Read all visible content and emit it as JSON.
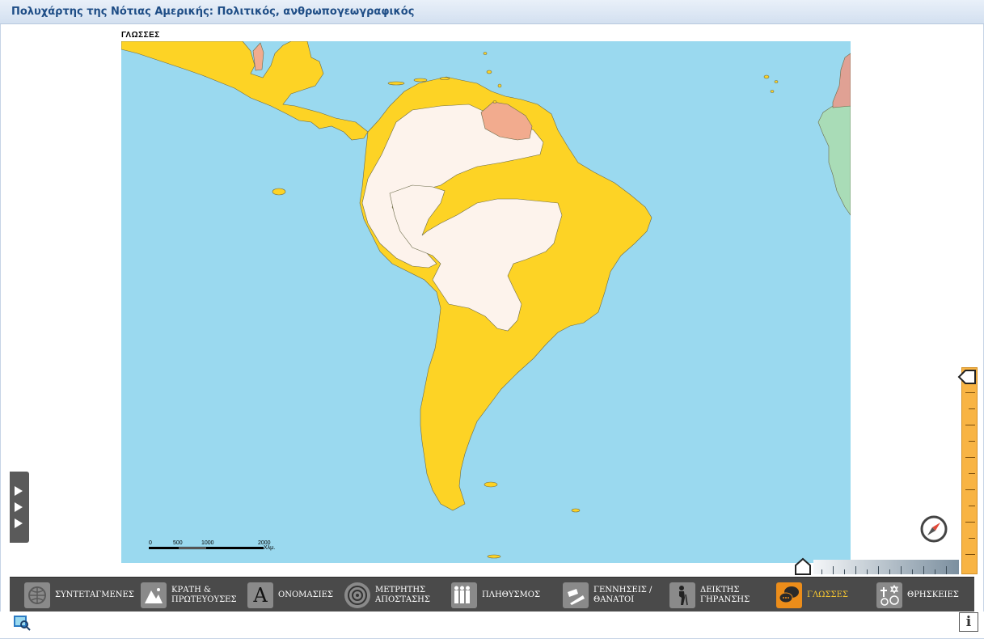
{
  "title": "Πολυχάρτης της Νότιας Αμερικής: Πολιτικός, ανθρωπογεωγραφικός",
  "map": {
    "layer_label": "ΓΛΩΣΣΕΣ",
    "colors": {
      "ocean": "#9ad9ef",
      "spanish_portuguese": "#fdd325",
      "indigenous": "#fdf3ec",
      "other_european": "#f2ab8e",
      "africa_green": "#a9dcb7",
      "africa_pink": "#e0a194"
    }
  },
  "scale": {
    "ticks": [
      "0",
      "500",
      "1000",
      "2000"
    ],
    "unit": "Χλμ."
  },
  "toolbar": {
    "items": [
      {
        "label": "ΣΥΝΤΕΤΑΓΜΕΝΕΣ",
        "icon": "globe-icon",
        "active": false
      },
      {
        "label": "ΚΡΑΤΗ &\nΠΡΩΤΕΥΟΥΣΕΣ",
        "icon": "mountains-icon",
        "active": false
      },
      {
        "label": "ΟΝΟΜΑΣΙΕΣ",
        "icon": "letter-a-icon",
        "active": false
      },
      {
        "label": "ΜΕΤΡΗΤΗΣ\nΑΠΟΣΤΑΣΗΣ",
        "icon": "target-icon",
        "active": false
      },
      {
        "label": "ΠΛΗΘΥΣΜΟΣ",
        "icon": "people-icon",
        "active": false
      },
      {
        "label": "ΓΕΝΝΗΣΕΙΣ /\nΘΑΝΑΤΟΙ",
        "icon": "cradle-icon",
        "active": false
      },
      {
        "label": "ΔΕΙΚΤΗΣ\nΓΗΡΑΝΣΗΣ",
        "icon": "elderly-icon",
        "active": false
      },
      {
        "label": "ΓΛΩΣΣΕΣ",
        "icon": "speech-bubbles-icon",
        "active": true
      },
      {
        "label": "ΘΡΗΣΚΕΙΕΣ",
        "icon": "religion-symbols-icon",
        "active": false
      }
    ]
  },
  "info_label": "i"
}
